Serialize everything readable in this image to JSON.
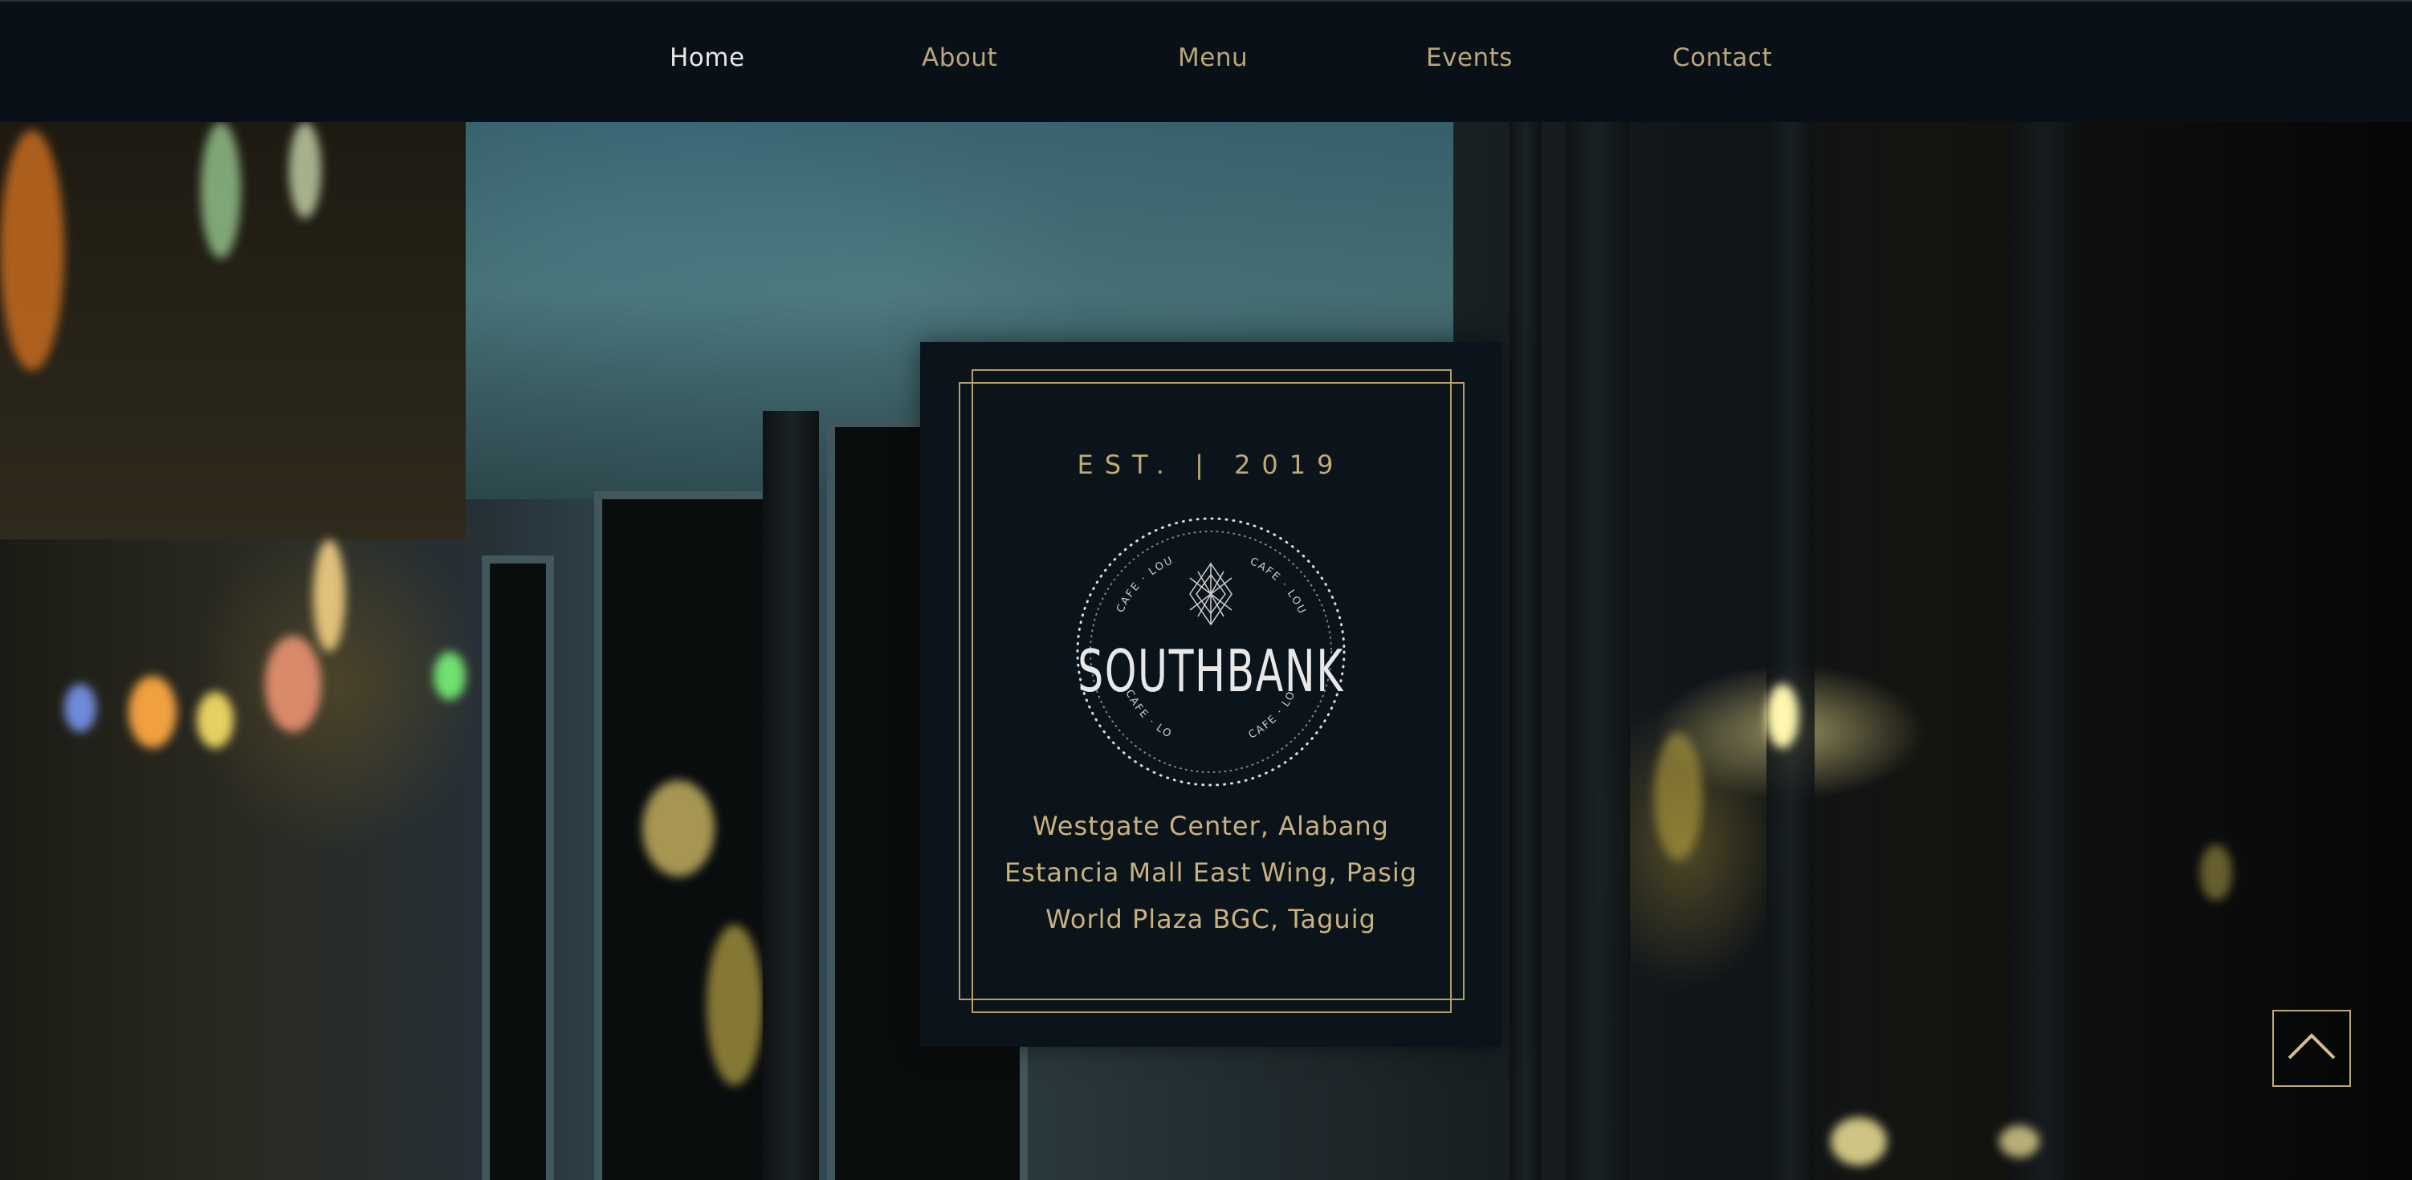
{
  "nav": {
    "items": [
      {
        "label": "Home",
        "active": true
      },
      {
        "label": "About",
        "active": false
      },
      {
        "label": "Menu",
        "active": false
      },
      {
        "label": "Events",
        "active": false
      },
      {
        "label": "Contact",
        "active": false
      }
    ]
  },
  "card": {
    "est": "EST. | 2019",
    "brand": "SOUTHBANK",
    "badge_text": "CAFE · LOUNGE",
    "locations": [
      "Westgate Center, Alabang",
      "Estancia Mall East Wing, Pasig",
      "World Plaza BGC, Taguig"
    ]
  },
  "scroll_top_icon": "chevron-up-icon",
  "colors": {
    "accent_gold": "#c0aa74",
    "nav_bg": "#0a1017",
    "card_bg": "#0b131b",
    "active_nav": "#e6e6e6"
  }
}
